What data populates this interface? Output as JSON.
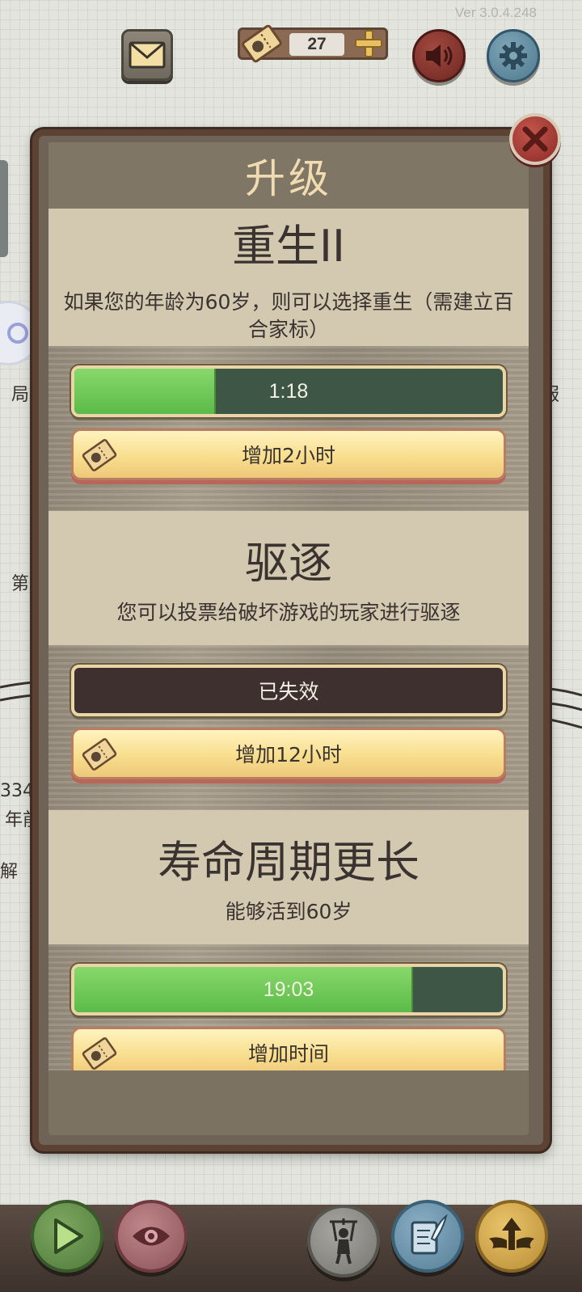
{
  "version": "Ver 3.0.4.248",
  "topbar": {
    "ticket_count": "27"
  },
  "background": {
    "left_text_1": "局",
    "left_text_2": "第",
    "left_text_3": "334",
    "left_text_4": "年前",
    "left_text_5": "解",
    "right_text_1": "服"
  },
  "modal": {
    "title": "升级",
    "sections": [
      {
        "title": "重生II",
        "description": "如果您的年龄为60岁，则可以选择重生（需建立百合家标）",
        "status_text": "1:18",
        "progress": 0.33,
        "button_label": "增加2小时"
      },
      {
        "title": "驱逐",
        "description": "您可以投票给破坏游戏的玩家进行驱逐",
        "status_text": "已失效",
        "button_label": "增加12小时"
      },
      {
        "title": "寿命周期更长",
        "description": "能够活到60岁",
        "status_text": "19:03",
        "progress": 0.79,
        "button_label": "增加时间"
      }
    ]
  },
  "colors": {
    "modal_frame": "#5b4232",
    "info_panel": "#d3c8b0",
    "progress_fill": "#6cc655",
    "button_gold": "#f8de8e",
    "close_red": "#a7413a"
  },
  "icons": [
    "mail-icon",
    "ticket-icon",
    "plus-icon",
    "speaker-icon",
    "gear-icon",
    "close-icon",
    "play-icon",
    "eye-icon",
    "puppet-icon",
    "scroll-quill-icon",
    "winged-arrow-icon"
  ]
}
